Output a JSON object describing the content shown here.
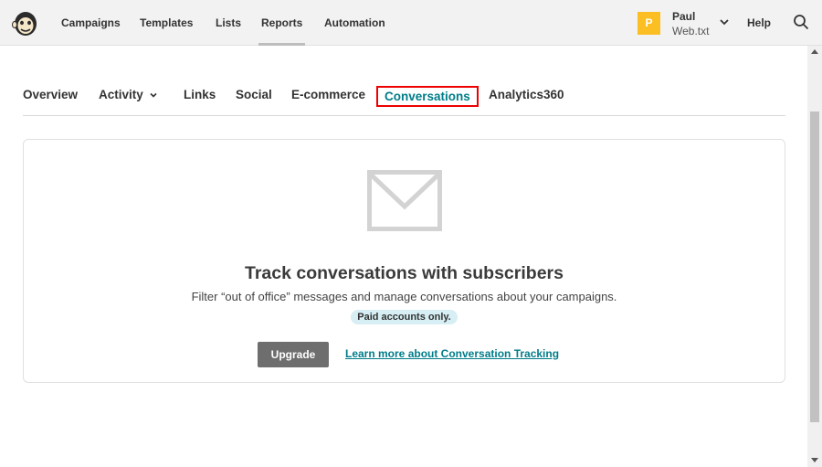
{
  "topnav": {
    "items": [
      {
        "label": "Campaigns"
      },
      {
        "label": "Templates"
      },
      {
        "label": "Lists"
      },
      {
        "label": "Reports"
      },
      {
        "label": "Automation"
      }
    ],
    "active": "Reports"
  },
  "user": {
    "initial": "P",
    "name": "Paul",
    "org": "Web.txt"
  },
  "help_label": "Help",
  "tabs": [
    {
      "label": "Overview"
    },
    {
      "label": "Activity"
    },
    {
      "label": "Links"
    },
    {
      "label": "Social"
    },
    {
      "label": "E-commerce"
    },
    {
      "label": "Conversations"
    },
    {
      "label": "Analytics360"
    }
  ],
  "selected_tab": "Conversations",
  "card": {
    "title": "Track conversations with subscribers",
    "description": "Filter “out of office” messages and manage conversations about your campaigns.",
    "badge": "Paid accounts only.",
    "upgrade_label": "Upgrade",
    "learn_more_label": "Learn more about Conversation Tracking"
  },
  "colors": {
    "accent": "#007c89",
    "avatar": "#fbbf24",
    "highlight_border": "#e00000",
    "badge_bg": "#d6eef4"
  },
  "icons": [
    "mailchimp-logo-icon",
    "chevron-down-icon",
    "search-icon",
    "envelope-icon"
  ]
}
